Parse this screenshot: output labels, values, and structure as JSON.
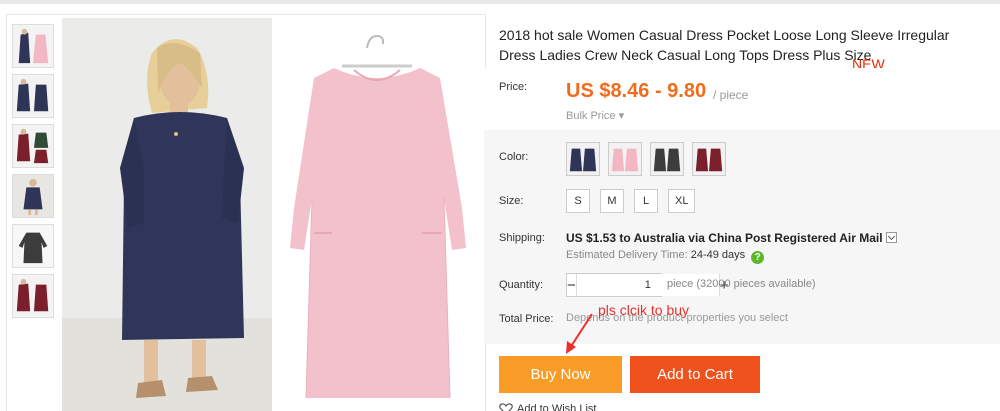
{
  "product": {
    "title": "2018 hot sale Women Casual Dress Pocket Loose Long Sleeve Irregular Dress Ladies Crew Neck Casual Long Tops Dress Plus Size",
    "badge": "NEW"
  },
  "thumbnails": [
    {
      "icon": "navy-and-pink-dress-thumbnail"
    },
    {
      "icon": "navy-dress-thumbnail"
    },
    {
      "icon": "wine-and-green-dress-thumbnail"
    },
    {
      "icon": "navy-dress-model-thumbnail"
    },
    {
      "icon": "gray-dress-thumbnail"
    },
    {
      "icon": "wine-dress-thumbnail"
    }
  ],
  "price": {
    "label": "Price:",
    "value": "US $8.46 - 9.80",
    "unit": "/ piece",
    "bulk": "Bulk Price ▾"
  },
  "color": {
    "label": "Color:",
    "swatches": [
      {
        "name": "navy",
        "color": "#2f3556"
      },
      {
        "name": "pink",
        "color": "#f1b8c4"
      },
      {
        "name": "dark-gray",
        "color": "#3c3c3c"
      },
      {
        "name": "wine-red",
        "color": "#7a1f2b"
      }
    ]
  },
  "size": {
    "label": "Size:",
    "options": [
      "S",
      "M",
      "L",
      "XL"
    ]
  },
  "shipping": {
    "label": "Shipping:",
    "method": "US $1.53 to Australia via China Post Registered Air Mail",
    "delivery_label": "Estimated Delivery Time:",
    "delivery_days": "24-49 days",
    "help": "?"
  },
  "quantity": {
    "label": "Quantity:",
    "minus": "−",
    "value": "1",
    "plus": "+",
    "available": "piece (32000 pieces available)"
  },
  "total": {
    "label": "Total Price:",
    "note": "Depends on the product properties you select"
  },
  "annotation": {
    "text": "pls clcik to buy"
  },
  "actions": {
    "buy_now": "Buy Now",
    "add_to_cart": "Add to Cart",
    "wishlist": "Add to Wish List"
  },
  "colors": {
    "price": "#f26b1d",
    "buy_now": "#f99b27",
    "add_to_cart": "#f0521d",
    "annotation": "#e8302a"
  }
}
